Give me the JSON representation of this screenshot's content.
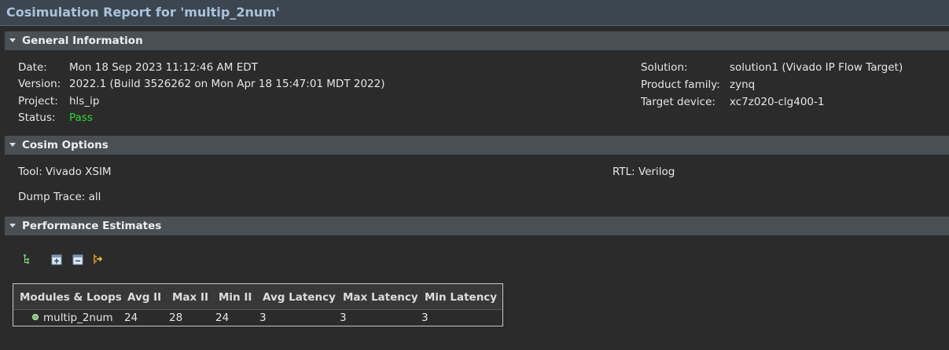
{
  "report": {
    "title": "Cosimulation Report for 'multip_2num'"
  },
  "general_information": {
    "header": "General Information",
    "left": [
      {
        "label": "Date:",
        "value": "Mon 18 Sep 2023 11:12:46 AM EDT"
      },
      {
        "label": "Version:",
        "value": "2022.1 (Build 3526262 on Mon Apr 18 15:47:01 MDT 2022)"
      },
      {
        "label": "Project:",
        "value": "hls_ip"
      },
      {
        "label": "Status:",
        "value": "Pass"
      }
    ],
    "right": [
      {
        "label": "Solution:",
        "value": "solution1 (Vivado IP Flow Target)"
      },
      {
        "label": "Product family:",
        "value": "zynq"
      },
      {
        "label": "Target device:",
        "value": "xc7z020-clg400-1"
      }
    ]
  },
  "cosim_options": {
    "header": "Cosim Options",
    "tool": "Tool: Vivado XSIM",
    "rtl": "RTL: Verilog",
    "dump_trace": "Dump Trace: all"
  },
  "performance_estimates": {
    "header": "Performance Estimates",
    "toolbar_icons": [
      "hierarchy-icon",
      "expand-all-icon",
      "collapse-all-icon",
      "goto-source-icon"
    ],
    "columns": [
      "Modules & Loops",
      "Avg II",
      "Max II",
      "Min II",
      "Avg Latency",
      "Max Latency",
      "Min Latency"
    ],
    "rows": [
      [
        "multip_2num",
        "24",
        "28",
        "24",
        "3",
        "3",
        "3"
      ]
    ]
  },
  "colors": {
    "pass": "#33d633",
    "title": "#a9c3db",
    "section_header_bg": "#4a4f54"
  }
}
